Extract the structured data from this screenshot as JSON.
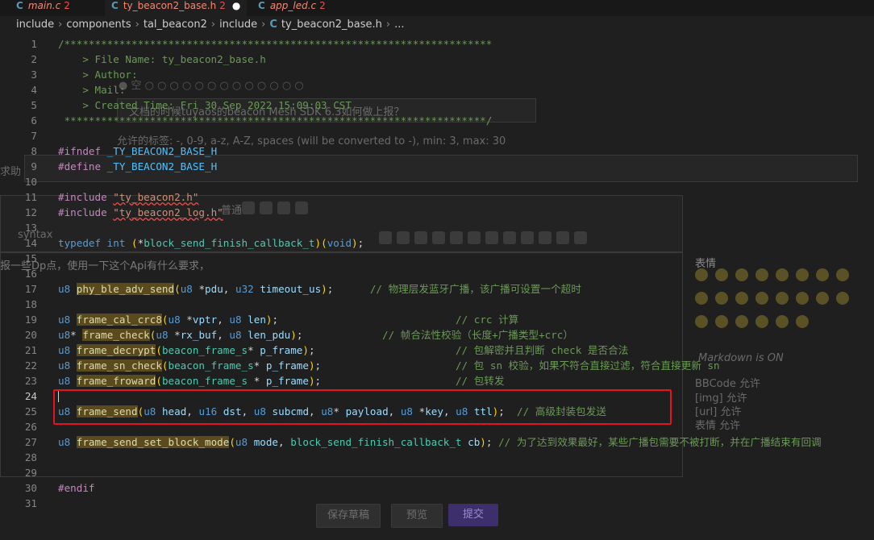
{
  "tabs": [
    {
      "label": "main.c",
      "errors": "2"
    },
    {
      "label": "ty_beacon2_base.h",
      "errors": "2",
      "dirty": "●"
    },
    {
      "label": "app_led.c",
      "errors": "2"
    }
  ],
  "breadcrumb": [
    "include",
    "components",
    "tal_beacon2",
    "include",
    "ty_beacon2_base.h",
    "..."
  ],
  "background": {
    "question": "文档的时候tuyaos的beacon Mesh SDK 6.3如何做上报？",
    "hint": "允许的标签: -, 0-9, a-z, A-Z, spaces (will be converted to -), min: 3, max: 30",
    "body_text": "报一些Dp点，使用一下这个Api有什么要求，",
    "left_fragment": "求助",
    "syntax_label": "syntax",
    "font_select": "普通",
    "emoji_title": "表情",
    "markdown": "Markdown is ON",
    "permissions": [
      "BBCode 允许",
      "[img] 允许",
      "[url] 允许",
      "表情 允许"
    ],
    "buttons": {
      "save": "保存草稿",
      "preview": "预览",
      "submit": "提交"
    },
    "accent": "#3d2f6b"
  },
  "code_lines": [
    {
      "n": "1",
      "t": "/**********************************************************************"
    },
    {
      "n": "2",
      "t": "    > File Name: ty_beacon2_base.h"
    },
    {
      "n": "3",
      "t": "    > Author:"
    },
    {
      "n": "4",
      "t": "    > Mail:"
    },
    {
      "n": "5",
      "t": "    > Created Time: Fri 30 Sep 2022 15:09:03 CST"
    },
    {
      "n": "6",
      "t": " *********************************************************************/"
    },
    {
      "n": "7",
      "t": ""
    },
    {
      "n": "8",
      "t": "#ifndef _TY_BEACON2_BASE_H"
    },
    {
      "n": "9",
      "t": "#define _TY_BEACON2_BASE_H"
    },
    {
      "n": "10",
      "t": ""
    },
    {
      "n": "11",
      "t": "#include \"ty_beacon2.h\""
    },
    {
      "n": "12",
      "t": "#include \"ty_beacon2_log.h\""
    },
    {
      "n": "13",
      "t": ""
    },
    {
      "n": "14",
      "t": "typedef int (*block_send_finish_callback_t)(void);"
    },
    {
      "n": "15",
      "t": ""
    },
    {
      "n": "16",
      "t": ""
    },
    {
      "n": "17",
      "t": "u8 phy_ble_adv_send(u8 *pdu, u32 timeout_us);      // 物理层发蓝牙广播，该广播可设置一个超时"
    },
    {
      "n": "18",
      "t": ""
    },
    {
      "n": "19",
      "t": "u8 frame_cal_crc8(u8 *vptr, u8 len);                             // crc 计算"
    },
    {
      "n": "20",
      "t": "u8* frame_check(u8 *rx_buf, u8 len_pdu);             // 帧合法性校验（长度+广播类型+crc）"
    },
    {
      "n": "21",
      "t": "u8 frame_decrypt(beacon_frame_s* p_frame);                       // 包解密并且判断 check 是否合法"
    },
    {
      "n": "22",
      "t": "u8 frame_sn_check(beacon_frame_s* p_frame);                      // 包 sn 校验，如果不符合直接过滤，符合直接更新 sn"
    },
    {
      "n": "23",
      "t": "u8 frame_froward(beacon_frame_s * p_frame);                      // 包转发"
    },
    {
      "n": "24",
      "t": ""
    },
    {
      "n": "25",
      "t": "u8 frame_send(u8 head, u16 dst, u8 subcmd, u8* payload, u8 *key, u8 ttl);  // 高级封装包发送"
    },
    {
      "n": "26",
      "t": ""
    },
    {
      "n": "27",
      "t": "u8 frame_send_set_block_mode(u8 mode, block_send_finish_callback_t cb); // 为了达到效果最好，某些广播包需要不被打断，并在广播结束有回调"
    },
    {
      "n": "28",
      "t": ""
    },
    {
      "n": "29",
      "t": ""
    },
    {
      "n": "30",
      "t": "#endif"
    },
    {
      "n": "31",
      "t": ""
    }
  ]
}
